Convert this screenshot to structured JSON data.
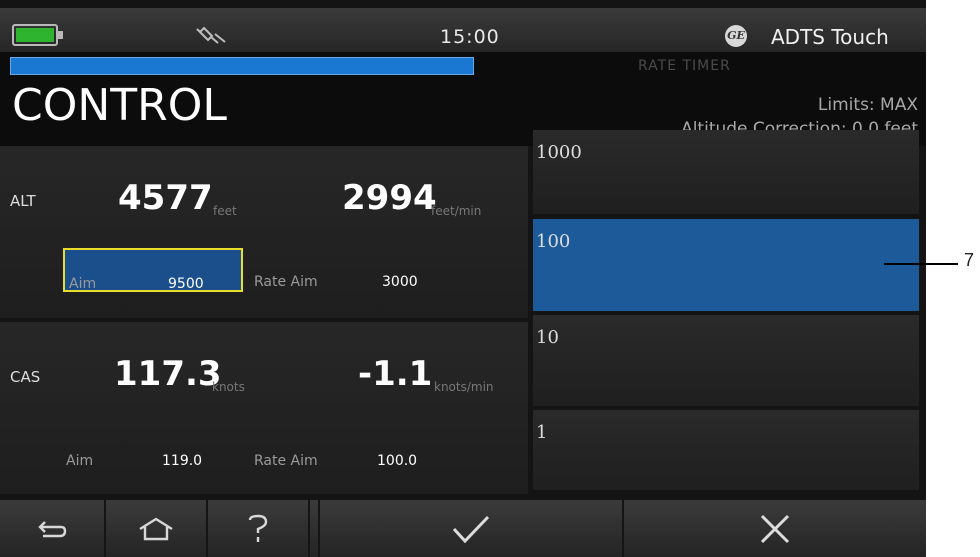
{
  "status_bar": {
    "battery_icon": "battery-full-icon",
    "battery_color": "#2fb42f",
    "connection_icon": "usb-plug-disconnected-icon",
    "time": "15:00",
    "logo_icon": "ge-logo-icon",
    "logo_text": "GE",
    "device_name": "ADTS Touch"
  },
  "header": {
    "progress_value": 1.0,
    "progress_color": "#1a78d2",
    "rate_timer_label": "RATE TIMER",
    "title": "CONTROL",
    "limits": "Limits: MAX",
    "altitude_correction": "Altitude Correction: 0.0 feet"
  },
  "alt_panel": {
    "label": "ALT",
    "value": "4577",
    "unit": "feet",
    "rate": "2994",
    "rate_unit": "feet/min",
    "aim_label": "Aim",
    "aim_value": "9500",
    "rate_aim_label": "Rate Aim",
    "rate_aim_value": "3000",
    "aim_highlight_color": "#e8dd2a"
  },
  "cas_panel": {
    "label": "CAS",
    "value": "117.3",
    "unit": "knots",
    "rate": "-1.1",
    "rate_unit": "knots/min",
    "aim_label": "Aim",
    "aim_value": "119.0",
    "rate_aim_label": "Rate Aim",
    "rate_aim_value": "100.0"
  },
  "increments": [
    {
      "label": "1000",
      "selected": false
    },
    {
      "label": "100",
      "selected": true
    },
    {
      "label": "10",
      "selected": false
    },
    {
      "label": "1",
      "selected": false
    }
  ],
  "selected_color": "#1d5a9a",
  "bottom_bar": {
    "back_icon": "back-arrow-icon",
    "home_icon": "home-icon",
    "help_icon": "help-icon",
    "confirm_icon": "checkmark-icon",
    "cancel_icon": "close-icon"
  },
  "callout": "7"
}
